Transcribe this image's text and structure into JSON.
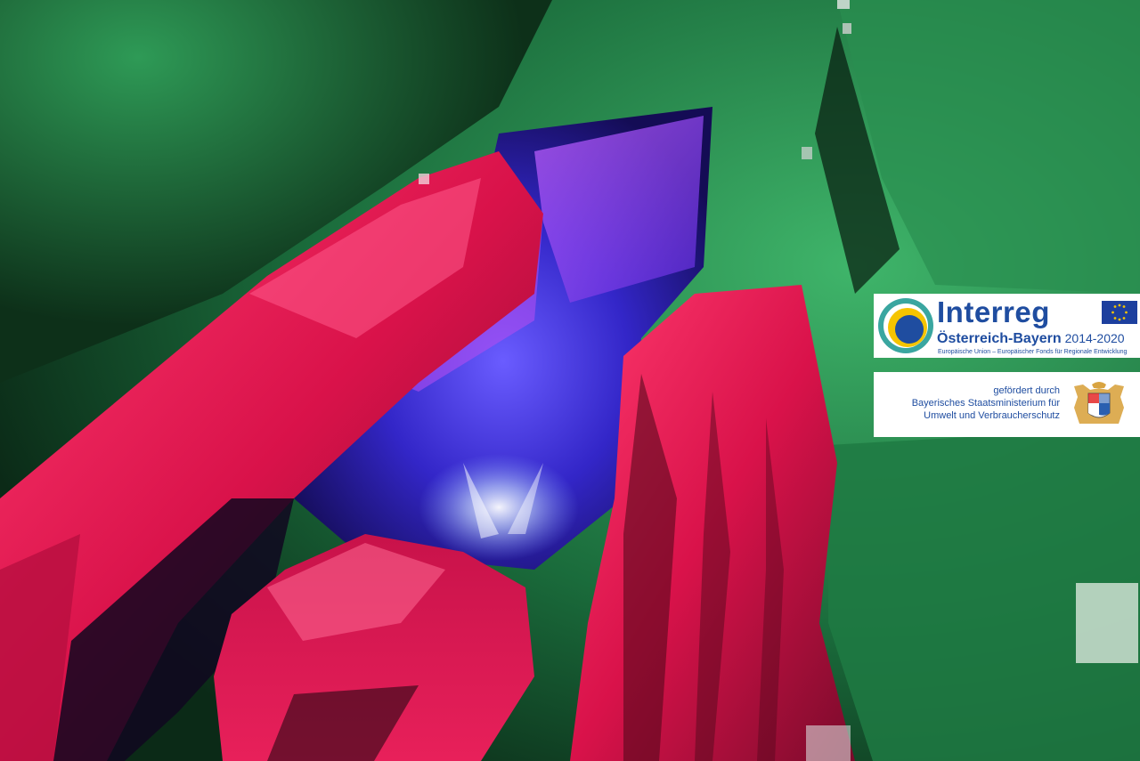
{
  "photo": {
    "subject": "illuminated-cave-interior",
    "colors": {
      "green": "#1e8a4c",
      "red": "#e0184e",
      "blue": "#3a2ed0",
      "violet": "#8a3ee8",
      "mist": "#cfe6ff"
    }
  },
  "interreg_logo": {
    "wordmark": "Interreg",
    "region": "Österreich-Bayern",
    "years": "2014-2020",
    "fund_line": "Europäische Union – Europäischer Fonds für Regionale Entwicklung",
    "colors": {
      "blue": "#1f4da0",
      "yellow": "#f5c400",
      "teal": "#3aa6a0",
      "eu_flag": "#1d3f9e"
    }
  },
  "funding_logo": {
    "line1": "gefördert durch",
    "line2": "Bayerisches Staatsministerium für",
    "line3": "Umwelt und Verbraucherschutz",
    "emblem": "bavarian-coat-of-arms-icon"
  }
}
